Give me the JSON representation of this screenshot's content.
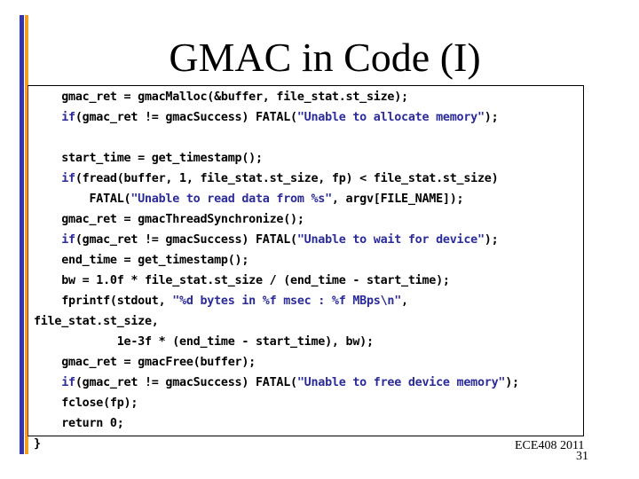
{
  "slide": {
    "title": "GMAC in Code (I)",
    "footer": "ECE408 2011",
    "page_number": "31",
    "colors": {
      "accent_bar_blue": "#3535b0",
      "accent_bar_orange": "#f0a020",
      "keyword": "#2b2b9a",
      "string": "#2b2b9a"
    }
  },
  "code": {
    "lines": [
      {
        "pre": "    gmac_ret = gmacMalloc(&buffer, file_stat.st_size);",
        "kw": "",
        "mid": "",
        "str": "",
        "post": ""
      },
      {
        "pre": "    ",
        "kw": "if",
        "mid": "(gmac_ret != gmacSuccess) FATAL(",
        "str": "\"Unable to allocate memory\"",
        "post": ");"
      },
      {
        "pre": "",
        "kw": "",
        "mid": "",
        "str": "",
        "post": ""
      },
      {
        "pre": "    start_time = get_timestamp();",
        "kw": "",
        "mid": "",
        "str": "",
        "post": ""
      },
      {
        "pre": "    ",
        "kw": "if",
        "mid": "(fread(buffer, 1, file_stat.st_size, fp) < file_stat.st_size)",
        "str": "",
        "post": ""
      },
      {
        "pre": "        FATAL(",
        "kw": "",
        "mid": "",
        "str": "\"Unable to read data from %s\"",
        "post": ", argv[FILE_NAME]);"
      },
      {
        "pre": "    gmac_ret = gmacThreadSynchronize();",
        "kw": "",
        "mid": "",
        "str": "",
        "post": ""
      },
      {
        "pre": "    ",
        "kw": "if",
        "mid": "(gmac_ret != gmacSuccess) FATAL(",
        "str": "\"Unable to wait for device\"",
        "post": ");"
      },
      {
        "pre": "    end_time = get_timestamp();",
        "kw": "",
        "mid": "",
        "str": "",
        "post": ""
      },
      {
        "pre": "    bw = 1.0f * file_stat.st_size / (end_time - start_time);",
        "kw": "",
        "mid": "",
        "str": "",
        "post": ""
      },
      {
        "pre": "    fprintf(stdout, ",
        "kw": "",
        "mid": "",
        "str": "\"%d bytes in %f msec : %f MBps\\n\"",
        "post": ","
      },
      {
        "pre": "file_stat.st_size,",
        "kw": "",
        "mid": "",
        "str": "",
        "post": ""
      },
      {
        "pre": "            1e-3f * (end_time - start_time), bw);",
        "kw": "",
        "mid": "",
        "str": "",
        "post": ""
      },
      {
        "pre": "    gmac_ret = gmacFree(buffer);",
        "kw": "",
        "mid": "",
        "str": "",
        "post": ""
      },
      {
        "pre": "    ",
        "kw": "if",
        "mid": "(gmac_ret != gmacSuccess) FATAL(",
        "str": "\"Unable to free device memory\"",
        "post": ");"
      },
      {
        "pre": "    fclose(fp);",
        "kw": "",
        "mid": "",
        "str": "",
        "post": ""
      },
      {
        "pre": "    return 0;",
        "kw": "",
        "mid": "",
        "str": "",
        "post": ""
      },
      {
        "pre": "}",
        "kw": "",
        "mid": "",
        "str": "",
        "post": ""
      }
    ]
  }
}
